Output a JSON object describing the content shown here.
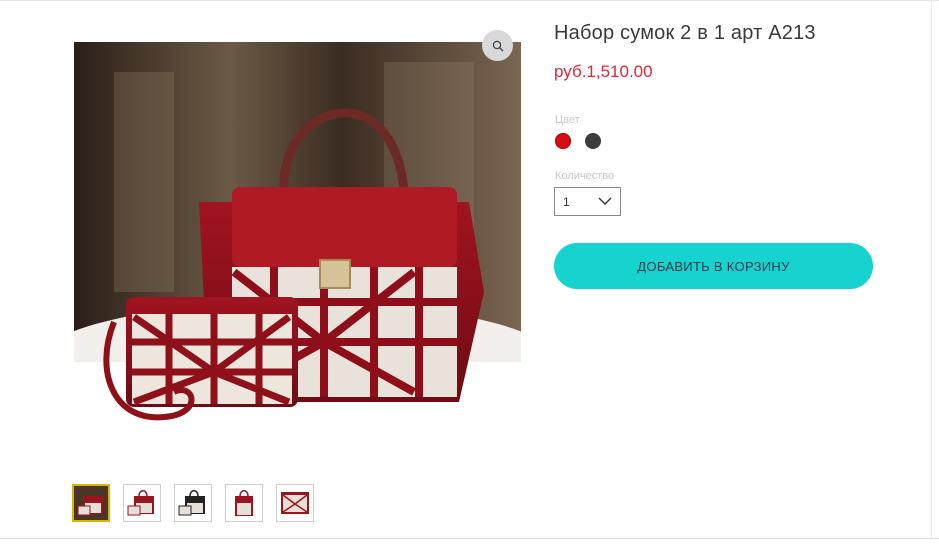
{
  "product": {
    "title": "Набор сумок 2 в 1 арт A213",
    "price": "руб.1,510.00"
  },
  "options": {
    "color_label": "Цвет",
    "colors": [
      "#d10f15",
      "#3c3c3c"
    ],
    "quantity_label": "Количество",
    "quantity_value": "1"
  },
  "actions": {
    "add_to_cart_label": "ДОБАВИТЬ В КОРЗИНУ"
  },
  "gallery": {
    "thumbnail_count": 5,
    "selected_index": 0
  },
  "colors": {
    "accent": "#16d3cf",
    "price": "#e0283a",
    "thumb_selected_border": "#d8b400"
  },
  "icons": {
    "zoom": "magnifier-icon",
    "select": "chevron-down-icon"
  }
}
